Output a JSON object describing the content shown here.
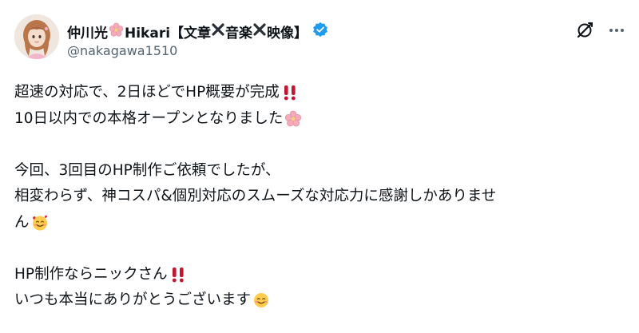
{
  "user": {
    "name_part1": "仲川光",
    "name_part2": "Hikari【文章",
    "name_part3": "音楽",
    "name_part4": "映像】",
    "handle": "@nakagawa1510"
  },
  "icons": {
    "name_flower": "cherry-blossom-icon",
    "name_cross": "cross-mark-icon",
    "verified": "verified-badge-icon",
    "grok": "grok-icon",
    "more": "more-options-icon",
    "avatar": "avatar"
  },
  "colors": {
    "verified_blue": "#1d9bf0",
    "handle_gray": "#536471",
    "text": "#0f1419",
    "exclamation_red": "#be1931",
    "blossom_pink": "#f4abba"
  },
  "post": {
    "line1": "超速の対応で、2日ほどでHP概要が完成",
    "line2": "10日以内での本格オープンとなりました",
    "line3": "今回、3回目のHP制作ご依頼でしたが、",
    "line4": "相変わらず、神コスパ&個別対応のスムーズな対応力に感謝しかありませ",
    "line5": "ん",
    "line6": "HP制作ならニックさん",
    "line7": "いつも本当にありがとうございます"
  }
}
